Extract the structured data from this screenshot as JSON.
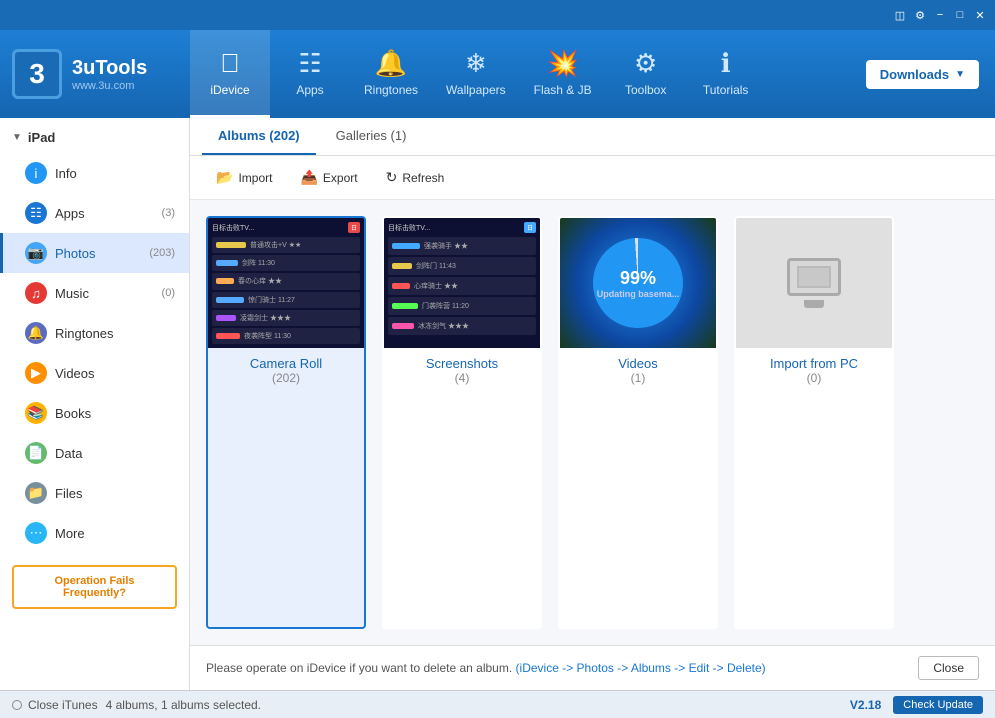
{
  "app": {
    "title": "3uTools",
    "url": "www.3u.com"
  },
  "titlebar": {
    "buttons": [
      "minimize",
      "maximize",
      "close"
    ],
    "icons": [
      "monitor-icon",
      "gear-icon",
      "minimize-icon",
      "maximize-icon",
      "close-icon"
    ]
  },
  "header": {
    "logo": "3",
    "brand": "3uTools",
    "website": "www.3u.com",
    "downloads_label": "Downloads",
    "nav_tabs": [
      {
        "id": "idevice",
        "label": "iDevice",
        "icon": "apple-icon"
      },
      {
        "id": "apps",
        "label": "Apps",
        "icon": "apps-icon"
      },
      {
        "id": "ringtones",
        "label": "Ringtones",
        "icon": "bell-icon"
      },
      {
        "id": "wallpapers",
        "label": "Wallpapers",
        "icon": "wallpaper-icon"
      },
      {
        "id": "flash-jb",
        "label": "Flash & JB",
        "icon": "flash-icon"
      },
      {
        "id": "toolbox",
        "label": "Toolbox",
        "icon": "toolbox-icon"
      },
      {
        "id": "tutorials",
        "label": "Tutorials",
        "icon": "info-icon"
      }
    ],
    "active_tab": "idevice"
  },
  "sidebar": {
    "device": "iPad",
    "items": [
      {
        "id": "info",
        "label": "Info",
        "count": "",
        "icon_type": "info"
      },
      {
        "id": "apps",
        "label": "Apps",
        "count": "(3)",
        "icon_type": "apps"
      },
      {
        "id": "photos",
        "label": "Photos",
        "count": "(203)",
        "icon_type": "photos",
        "active": true
      },
      {
        "id": "music",
        "label": "Music",
        "count": "(0)",
        "icon_type": "music"
      },
      {
        "id": "ringtones",
        "label": "Ringtones",
        "count": "",
        "icon_type": "ringtones"
      },
      {
        "id": "videos",
        "label": "Videos",
        "count": "",
        "icon_type": "videos"
      },
      {
        "id": "books",
        "label": "Books",
        "count": "",
        "icon_type": "books"
      },
      {
        "id": "data",
        "label": "Data",
        "count": "",
        "icon_type": "data"
      },
      {
        "id": "files",
        "label": "Files",
        "count": "",
        "icon_type": "files"
      },
      {
        "id": "more",
        "label": "More",
        "count": "",
        "icon_type": "more"
      }
    ],
    "promo": "Operation Fails Frequently?"
  },
  "content": {
    "tabs": [
      {
        "id": "albums",
        "label": "Albums (202)",
        "active": true
      },
      {
        "id": "galleries",
        "label": "Galleries (1)",
        "active": false
      }
    ],
    "toolbar": [
      {
        "id": "import",
        "label": "Import",
        "icon": "import-icon"
      },
      {
        "id": "export",
        "label": "Export",
        "icon": "export-icon"
      },
      {
        "id": "refresh",
        "label": "Refresh",
        "icon": "refresh-icon"
      }
    ],
    "albums": [
      {
        "id": "camera-roll",
        "name": "Camera Roll",
        "count": "(202)",
        "selected": true,
        "type": "camera"
      },
      {
        "id": "screenshots",
        "name": "Screenshots",
        "count": "(4)",
        "selected": false,
        "type": "screenshots"
      },
      {
        "id": "videos",
        "name": "Videos",
        "count": "(1)",
        "selected": false,
        "type": "videos"
      },
      {
        "id": "import-pc",
        "name": "Import from PC",
        "count": "(0)",
        "selected": false,
        "type": "import"
      }
    ],
    "info_bar": {
      "message": "Please operate on iDevice if you want to delete an album.",
      "path_hint": "(iDevice -> Photos -> Albums -> Edit -> Delete)",
      "close_label": "Close"
    }
  },
  "statusbar": {
    "itunes_label": "Close iTunes",
    "count_text": "4 albums, 1 albums selected.",
    "version": "V2.18",
    "check_update": "Check Update"
  }
}
